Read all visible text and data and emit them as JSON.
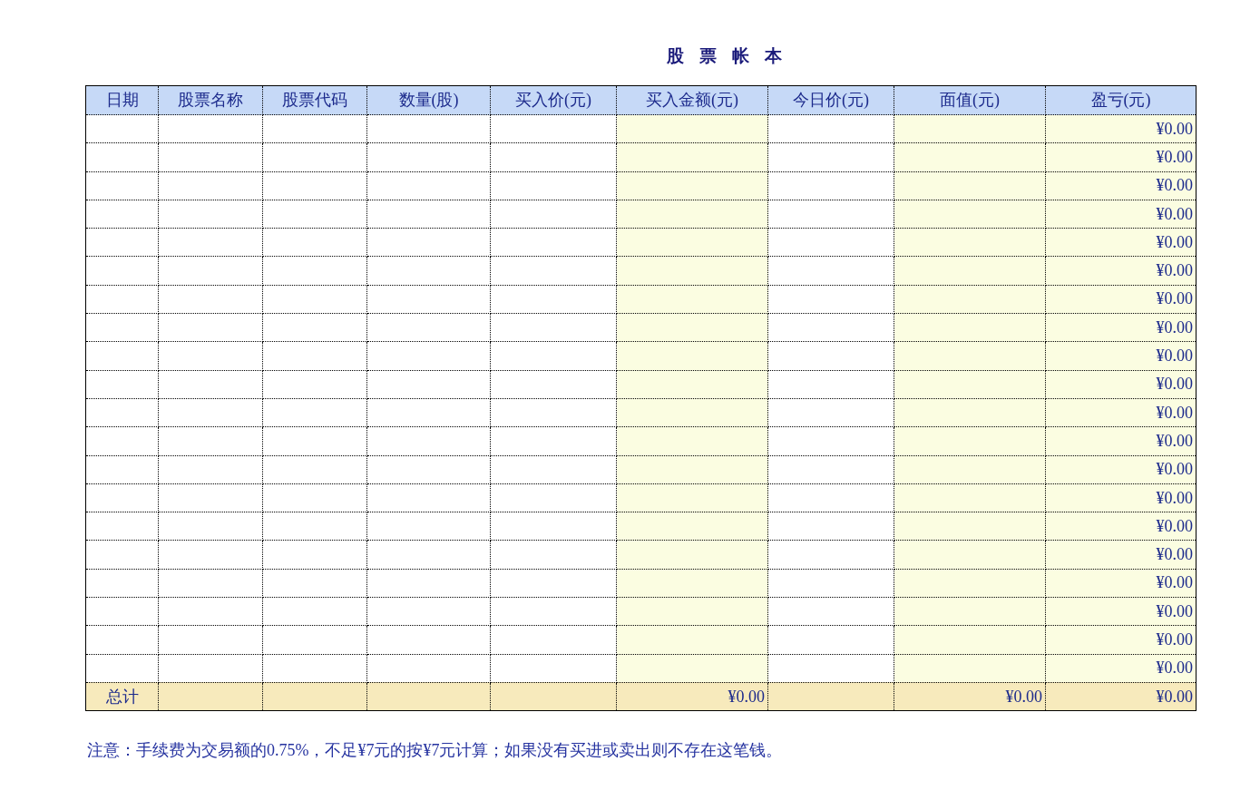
{
  "title": "股 票 帐 本",
  "columns": [
    {
      "label": "日期",
      "kind": "input"
    },
    {
      "label": "股票名称",
      "kind": "input"
    },
    {
      "label": "股票代码",
      "kind": "input"
    },
    {
      "label": "数量(股)",
      "kind": "input"
    },
    {
      "label": "买入价(元)",
      "kind": "input"
    },
    {
      "label": "买入金额(元)",
      "kind": "computed",
      "total": "¥0.00"
    },
    {
      "label": "今日价(元)",
      "kind": "input"
    },
    {
      "label": "面值(元)",
      "kind": "computed",
      "total": "¥0.00"
    },
    {
      "label": "盈亏(元)",
      "kind": "computed",
      "total": "¥0.00"
    }
  ],
  "rows": [
    {
      "profit_loss": "¥0.00"
    },
    {
      "profit_loss": "¥0.00"
    },
    {
      "profit_loss": "¥0.00"
    },
    {
      "profit_loss": "¥0.00"
    },
    {
      "profit_loss": "¥0.00"
    },
    {
      "profit_loss": "¥0.00"
    },
    {
      "profit_loss": "¥0.00"
    },
    {
      "profit_loss": "¥0.00"
    },
    {
      "profit_loss": "¥0.00"
    },
    {
      "profit_loss": "¥0.00"
    },
    {
      "profit_loss": "¥0.00"
    },
    {
      "profit_loss": "¥0.00"
    },
    {
      "profit_loss": "¥0.00"
    },
    {
      "profit_loss": "¥0.00"
    },
    {
      "profit_loss": "¥0.00"
    },
    {
      "profit_loss": "¥0.00"
    },
    {
      "profit_loss": "¥0.00"
    },
    {
      "profit_loss": "¥0.00"
    },
    {
      "profit_loss": "¥0.00"
    },
    {
      "profit_loss": "¥0.00"
    }
  ],
  "total_label": "总计",
  "note": "注意：手续费为交易额的0.75%，不足¥7元的按¥7元计算；如果没有买进或卖出则不存在这笔钱。"
}
